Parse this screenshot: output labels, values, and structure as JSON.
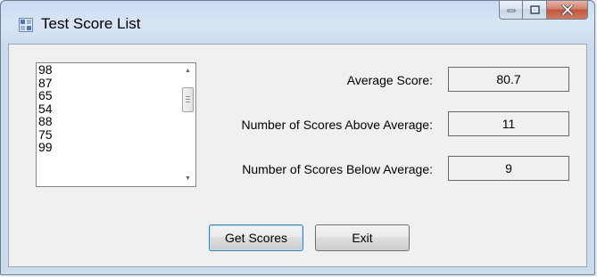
{
  "window": {
    "title": "Test Score List",
    "app_icon": "form-icon",
    "caption_buttons": [
      "minimize-icon",
      "maximize-icon",
      "close-icon"
    ]
  },
  "scores_list": {
    "items": [
      "98",
      "87",
      "65",
      "54",
      "88",
      "75",
      "99"
    ]
  },
  "stats": {
    "average_label": "Average Score:",
    "average_value": "80.7",
    "above_label": "Number of Scores Above Average:",
    "above_value": "11",
    "below_label": "Number of Scores Below Average:",
    "below_value": "9"
  },
  "buttons": {
    "get_scores": "Get Scores",
    "exit": "Exit"
  }
}
